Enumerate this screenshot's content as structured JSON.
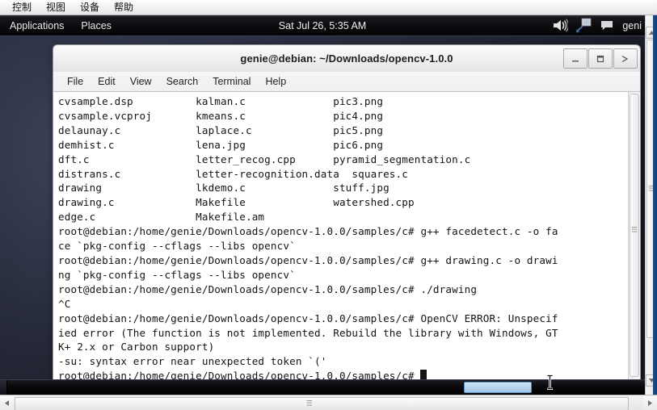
{
  "vm_menubar": {
    "items": [
      {
        "label": "控制",
        "name": "vm-menu-control"
      },
      {
        "label": "视图",
        "name": "vm-menu-view"
      },
      {
        "label": "设备",
        "name": "vm-menu-devices"
      },
      {
        "label": "帮助",
        "name": "vm-menu-help"
      }
    ]
  },
  "gnome_panel": {
    "applications_label": "Applications",
    "places_label": "Places",
    "clock": "Sat Jul 26,  5:35 AM",
    "user": "geni",
    "icons": {
      "volume": "volume-icon",
      "network": "network-icon",
      "chat": "chat-icon"
    }
  },
  "terminal": {
    "title": "genie@debian: ~/Downloads/opencv-1.0.0",
    "window_buttons": {
      "minimize": "minimize-icon",
      "maximize": "maximize-icon",
      "close": "close-icon"
    },
    "menu": [
      {
        "label": "File",
        "name": "terminal-menu-file"
      },
      {
        "label": "Edit",
        "name": "terminal-menu-edit"
      },
      {
        "label": "View",
        "name": "terminal-menu-view"
      },
      {
        "label": "Search",
        "name": "terminal-menu-search"
      },
      {
        "label": "Terminal",
        "name": "terminal-menu-terminal"
      },
      {
        "label": "Help",
        "name": "terminal-menu-help"
      }
    ],
    "lines": [
      "cvsample.dsp          kalman.c              pic3.png",
      "cvsample.vcproj       kmeans.c              pic4.png",
      "delaunay.c            laplace.c             pic5.png",
      "demhist.c             lena.jpg              pic6.png",
      "dft.c                 letter_recog.cpp      pyramid_segmentation.c",
      "distrans.c            letter-recognition.data  squares.c",
      "drawing               lkdemo.c              stuff.jpg",
      "drawing.c             Makefile              watershed.cpp",
      "edge.c                Makefile.am",
      "root@debian:/home/genie/Downloads/opencv-1.0.0/samples/c# g++ facedetect.c -o fa",
      "ce `pkg-config --cflags --libs opencv`",
      "root@debian:/home/genie/Downloads/opencv-1.0.0/samples/c# g++ drawing.c -o drawi",
      "ng `pkg-config --cflags --libs opencv`",
      "root@debian:/home/genie/Downloads/opencv-1.0.0/samples/c# ./drawing",
      "^C",
      "root@debian:/home/genie/Downloads/opencv-1.0.0/samples/c# OpenCV ERROR: Unspecif",
      "ied error (The function is not implemented. Rebuild the library with Windows, GT",
      "K+ 2.x or Carbon support)",
      "-su: syntax error near unexpected token `('"
    ],
    "prompt": "root@debian:/home/genie/Downloads/opencv-1.0.0/samples/c# "
  },
  "colors": {
    "panel_bg": "#0a0a0d",
    "desktop_bg": "#2c3144",
    "terminal_bg": "#ffffff",
    "terminal_fg": "#141414",
    "taskbar_active": "#9ec5e9"
  }
}
